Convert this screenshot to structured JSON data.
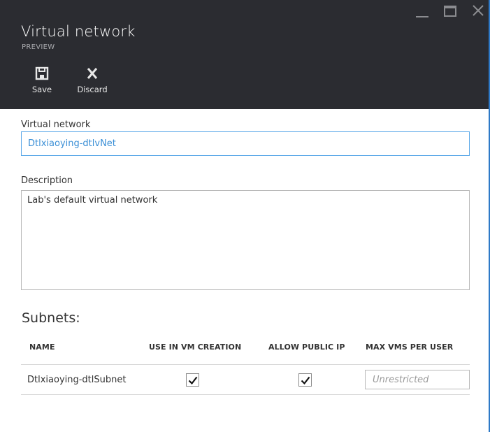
{
  "window": {
    "controls": [
      "minimize-icon",
      "maximize-icon",
      "close-icon"
    ]
  },
  "header": {
    "title": "Virtual network",
    "subtitle": "PREVIEW"
  },
  "commands": {
    "save": {
      "label": "Save",
      "icon": "save-icon"
    },
    "discard": {
      "label": "Discard",
      "icon": "close-x-icon"
    }
  },
  "form": {
    "vnet_label": "Virtual network",
    "vnet_value": "Dtlxiaoying-dtlvNet",
    "description_label": "Description",
    "description_value": "Lab's default virtual network"
  },
  "subnets": {
    "title": "Subnets:",
    "columns": [
      "NAME",
      "USE IN VM CREATION",
      "ALLOW PUBLIC IP",
      "MAX VMS PER USER"
    ],
    "rows": [
      {
        "name": "Dtlxiaoying-dtlSubnet",
        "use_in_vm_creation": true,
        "allow_public_ip": true,
        "max_vms_value": "",
        "max_vms_placeholder": "Unrestricted"
      }
    ]
  },
  "colors": {
    "header_bg": "#2b2c31",
    "accent": "#3a8fd6",
    "blade_edge": "#2d79c7"
  }
}
